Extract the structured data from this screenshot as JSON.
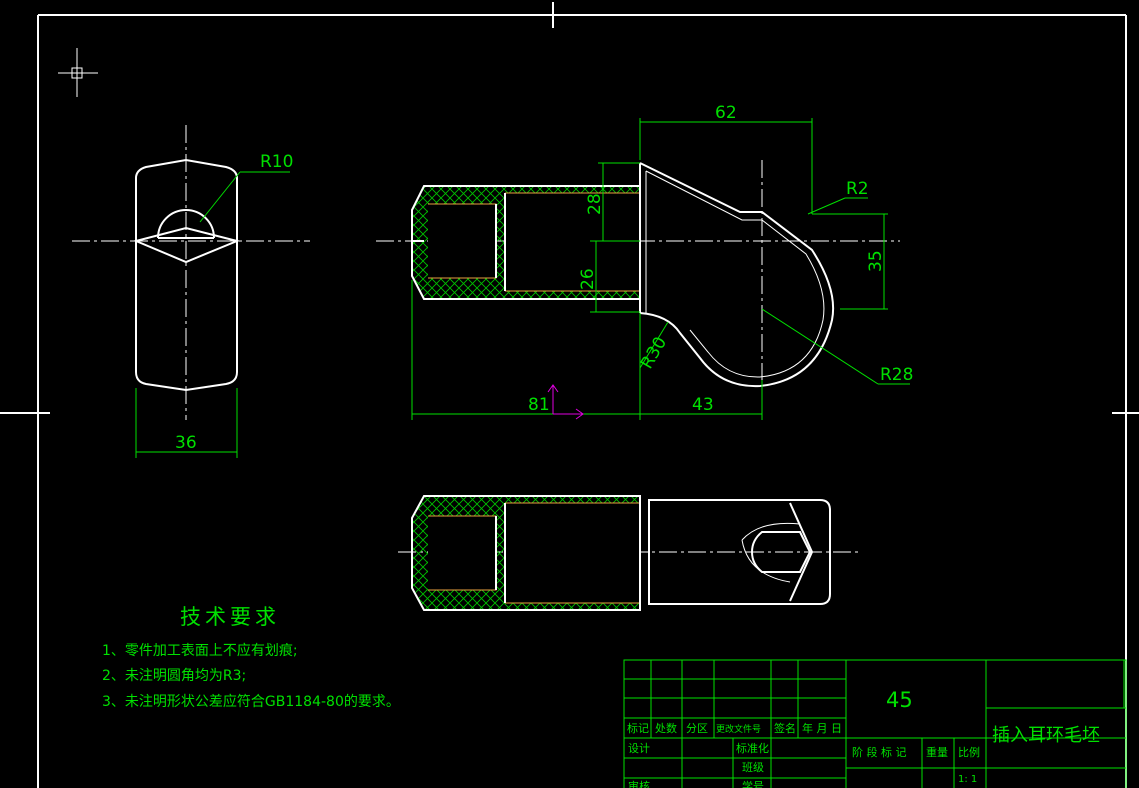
{
  "drawing": {
    "dimensions": {
      "r10": "R10",
      "d36": "36",
      "d62": "62",
      "r2": "R2",
      "d28": "28",
      "d26": "26",
      "d35": "35",
      "r30": "R30",
      "r28": "R28",
      "d81": "81",
      "d43": "43"
    }
  },
  "tech_requirements": {
    "title": "技术要求",
    "items": [
      "1、零件加工表面上不应有划痕;",
      "2、未注明圆角均为R3;",
      "3、未注明形状公差应符合GB1184-80的要求。"
    ]
  },
  "title_block": {
    "material": "45",
    "part_name": "插入耳环毛坯",
    "headers": {
      "mark": "标记",
      "count": "处数",
      "zone": "分区",
      "change_doc": "更改文件号",
      "signature": "签名",
      "date": "年 月 日",
      "design": "设计",
      "standardize": "标准化",
      "class": "班级",
      "student_no": "学号",
      "review": "审核",
      "stage_mark": "阶 段 标 记",
      "weight": "重量",
      "scale": "比例",
      "scale_value": "1: 1"
    }
  },
  "colors": {
    "background": "#000000",
    "geometry": "#ffffff",
    "dimension": "#00e000",
    "hidden_detail": "#e8a040",
    "ucs_icon": "#e000e0"
  }
}
